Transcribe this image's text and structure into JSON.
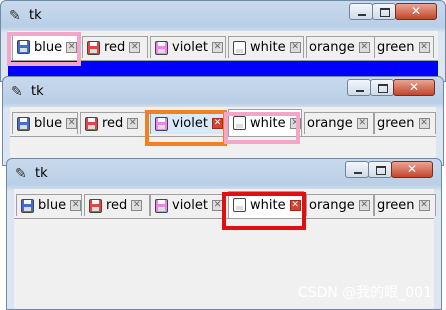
{
  "windows": [
    {
      "title": "tk",
      "tabs": [
        {
          "label": "blue",
          "color": "#3d6fd1"
        },
        {
          "label": "red",
          "color": "#e74343"
        },
        {
          "label": "violet",
          "color": "#ee82ee"
        },
        {
          "label": "white",
          "color": "#ffffff"
        },
        {
          "label": "orange",
          "color": "#ffa500"
        },
        {
          "label": "green",
          "color": "#3aa14a"
        }
      ],
      "selected": "blue",
      "content_color": "#0000ff"
    },
    {
      "title": "tk",
      "tabs": [
        {
          "label": "blue"
        },
        {
          "label": "red"
        },
        {
          "label": "violet"
        },
        {
          "label": "white"
        },
        {
          "label": "orange"
        },
        {
          "label": "green"
        }
      ],
      "selected": "white",
      "hover": "violet"
    },
    {
      "title": "tk",
      "tabs": [
        {
          "label": "blue"
        },
        {
          "label": "red"
        },
        {
          "label": "violet"
        },
        {
          "label": "white"
        },
        {
          "label": "orange"
        },
        {
          "label": "green"
        }
      ],
      "selected": "white",
      "close_pressed": "white"
    }
  ],
  "controls": {
    "minimize": "—",
    "maximize": "□",
    "close": "✕"
  },
  "close_glyph": "✕",
  "highlight_colors": {
    "pink": "#f4a6c8",
    "orange": "#f08020",
    "red": "#e01010"
  },
  "watermark": "CSDN @我的眼_001"
}
